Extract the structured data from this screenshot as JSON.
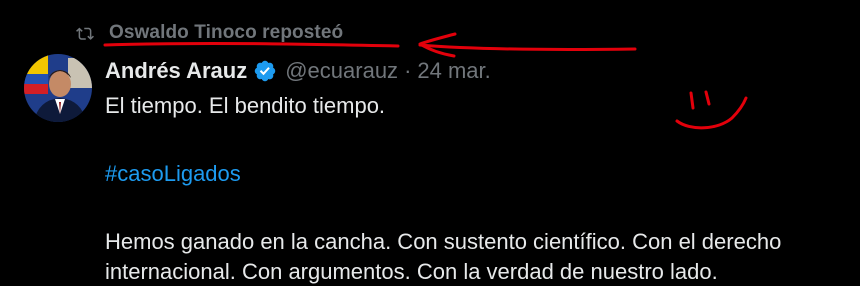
{
  "repost": {
    "icon": "repost-icon",
    "text": "Oswaldo Tinoco reposteó"
  },
  "tweet": {
    "author_name": "Andrés Arauz",
    "verified_icon": "verified-badge-icon",
    "handle": "@ecuarauz",
    "separator": "·",
    "date": "24 mar.",
    "lines": [
      "El tiempo. El bendito tiempo.",
      "#casoLigados",
      "Hemos ganado en la cancha. Con sustento científico. Con el derecho",
      "internacional. Con argumentos. Con la verdad de nuestro lado."
    ]
  },
  "colors": {
    "background": "#000000",
    "text_primary": "#e7e9ea",
    "text_secondary": "#71767b",
    "link": "#1d9bf0",
    "verified": "#1d9bf0",
    "annotation": "#e3000b"
  }
}
